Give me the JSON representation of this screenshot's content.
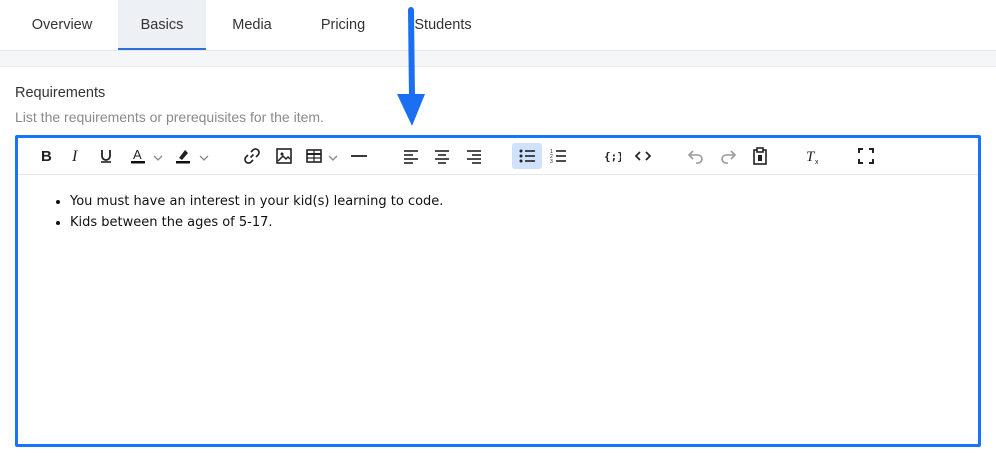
{
  "tabs": [
    {
      "label": "Overview",
      "active": false
    },
    {
      "label": "Basics",
      "active": true
    },
    {
      "label": "Media",
      "active": false
    },
    {
      "label": "Pricing",
      "active": false
    },
    {
      "label": "Students",
      "active": false
    }
  ],
  "field": {
    "label": "Requirements",
    "help": "List the requirements or prerequisites for the item."
  },
  "toolbar": {
    "buttons": [
      "bold-icon",
      "italic-icon",
      "underline-icon",
      "text-color-icon",
      "highlight-icon",
      "link-icon",
      "image-icon",
      "table-icon",
      "horizontal-rule-icon",
      "align-left-icon",
      "align-center-icon",
      "align-right-icon",
      "bullet-list-icon",
      "numbered-list-icon",
      "code-block-icon",
      "source-code-icon",
      "undo-icon",
      "redo-icon",
      "paste-icon",
      "clear-format-icon",
      "fullscreen-icon"
    ],
    "active": "bullet-list-icon"
  },
  "content": {
    "items": [
      "You must have an interest in your kid(s) learning to code.",
      "Kids between the ages of 5-17."
    ]
  },
  "colors": {
    "accent": "#1a73ff",
    "tab_underline": "#2f6fda",
    "active_button": "#cfe1fb"
  }
}
